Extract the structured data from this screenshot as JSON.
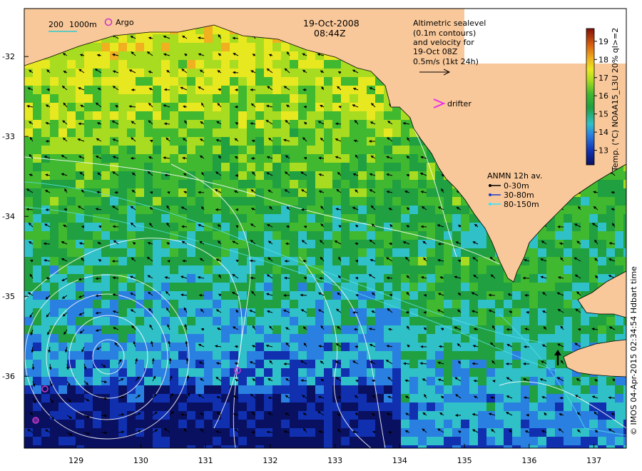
{
  "map": {
    "date": "19-Oct-2008",
    "time": "08:44Z",
    "scale_bar": {
      "label_left": "200",
      "label_right": "1000m"
    },
    "argo_label": "Argo",
    "altimetry_note": [
      "Altimetric sealevel",
      "(0.1m contours)",
      "and velocity for",
      "19-Oct 08Z",
      "0.5m/s (1kt 24h)"
    ],
    "drifter_label": "drifter",
    "anmn_legend": {
      "title": "ANMN 12h av.",
      "items": [
        {
          "label": "0-30m",
          "color": "#000000"
        },
        {
          "label": "30-80m",
          "color": "#1a3cc8"
        },
        {
          "label": "80-150m",
          "color": "#33e6ff"
        }
      ]
    },
    "colorbar": {
      "title": "Temp. (°C) NOAA15_L3U 20% ql>=2",
      "ticks": [
        "13",
        "14",
        "15",
        "16",
        "17",
        "18",
        "19"
      ],
      "min": 12.2,
      "max": 19.7
    },
    "credit": "© IMOS 04-Apr-2015 02:34:54 Hdbart time",
    "lat_labels": [
      "-32",
      "-33",
      "-34",
      "-35",
      "-36"
    ],
    "lon_labels": [
      "129",
      "130",
      "131",
      "132",
      "133",
      "134",
      "135",
      "136",
      "137"
    ],
    "lon_range": [
      128.2,
      137.5
    ],
    "lat_range": [
      -36.9,
      -31.4
    ],
    "colors": {
      "land": "#f9c89a",
      "ocean_background": "#3a8a3c",
      "contour": "#ffffff",
      "isobath": "#58e0e8",
      "argo": "#c838c8",
      "drifter": "#e82ee8"
    }
  }
}
